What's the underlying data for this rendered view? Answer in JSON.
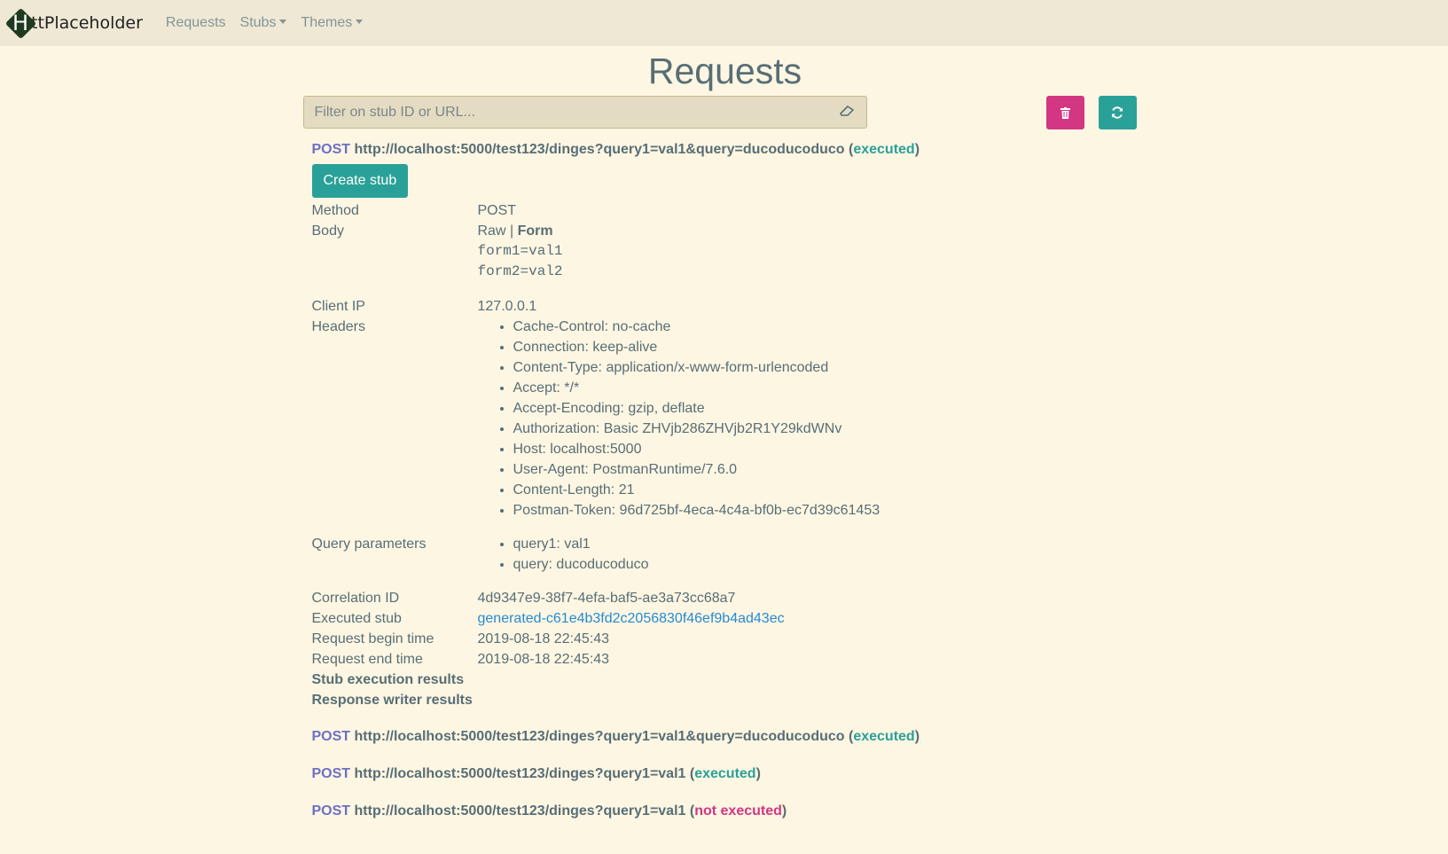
{
  "navbar": {
    "brand_letter": "H",
    "brand_text": "ttPlaceholder",
    "items": [
      "Requests",
      "Stubs",
      "Themes"
    ]
  },
  "page": {
    "title": "Requests",
    "filter_placeholder": "Filter on stub ID or URL..."
  },
  "expanded_request": {
    "method": "POST",
    "url": "http://localhost:5000/test123/dinges?query1=val1&query=ducoducoduco",
    "status": "executed",
    "create_stub_label": "Create stub",
    "labels": {
      "method": "Method",
      "body": "Body",
      "client_ip": "Client IP",
      "headers": "Headers",
      "query_parameters": "Query parameters",
      "correlation_id": "Correlation ID",
      "executed_stub": "Executed stub",
      "begin_time": "Request begin time",
      "end_time": "Request end time",
      "stub_execution_results": "Stub execution results",
      "response_writer_results": "Response writer results"
    },
    "method_value": "POST",
    "body_tabs": {
      "raw": "Raw",
      "separator": "|",
      "form": "Form"
    },
    "body_lines": [
      "form1=val1",
      "form2=val2"
    ],
    "client_ip": "127.0.0.1",
    "headers": [
      "Cache-Control: no-cache",
      "Connection: keep-alive",
      "Content-Type: application/x-www-form-urlencoded",
      "Accept: */*",
      "Accept-Encoding: gzip, deflate",
      "Authorization: Basic ZHVjb286ZHVjb2R1Y29kdWNv",
      "Host: localhost:5000",
      "User-Agent: PostmanRuntime/7.6.0",
      "Content-Length: 21",
      "Postman-Token: 96d725bf-4eca-4c4a-bf0b-ec7d39c61453"
    ],
    "query_parameters": [
      "query1: val1",
      "query: ducoducoduco"
    ],
    "correlation_id": "4d9347e9-38f7-4efa-baf5-ae3a73cc68a7",
    "executed_stub": "generated-c61e4b3fd2c2056830f46ef9b4ad43ec",
    "begin_time": "2019-08-18 22:45:43",
    "end_time": "2019-08-18 22:45:43"
  },
  "other_requests": [
    {
      "method": "POST",
      "url": "http://localhost:5000/test123/dinges?query1=val1&query=ducoducoduco",
      "status": "executed"
    },
    {
      "method": "POST",
      "url": "http://localhost:5000/test123/dinges?query1=val1",
      "status": "executed"
    },
    {
      "method": "POST",
      "url": "http://localhost:5000/test123/dinges?query1=val1",
      "status": "not executed"
    }
  ],
  "colors": {
    "background": "#fdf6e3",
    "navbar": "#eee8d5",
    "method": "#6c71c4",
    "executed": "#2aa198",
    "not_executed": "#d33682",
    "link": "#268bd2"
  }
}
